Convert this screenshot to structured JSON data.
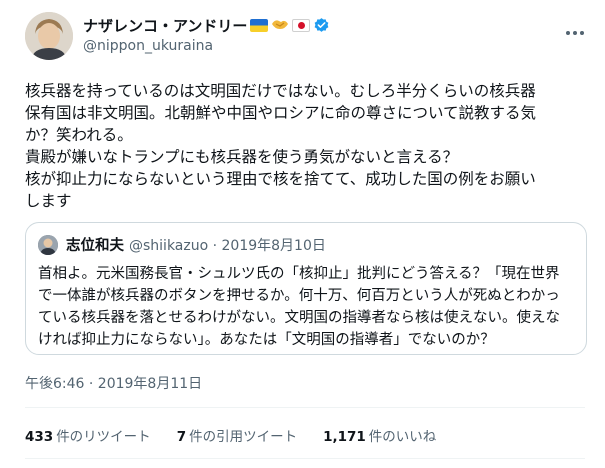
{
  "author": {
    "display_name": "ナザレンコ・アンドリー",
    "handle": "@nippon_ukuraina"
  },
  "tweet": {
    "lines": [
      "核兵器を持っているのは文明国だけではない。むしろ半分くらいの核兵器",
      "保有国は非文明国。北朝鮮や中国やロシアに命の尊さについて説教する気",
      "か？笑われる。",
      "貴殿が嫌いなトランプにも核兵器を使う勇気がないと言える？",
      "核が抑止力にならないという理由で核を捨てて、成功した国の例をお願い",
      "します"
    ]
  },
  "quoted_tweet": {
    "display_name": "志位和夫",
    "meta": "@shiikazuo · 2019年8月10日",
    "lines": [
      "首相よ。元米国務長官・シュルツ氏の「核抑止」批判にどう答える？「現在世界",
      "で一体誰が核兵器のボタンを押せるか。何十万、何百万という人が死ぬとわかっ",
      "ている核兵器を落とせるわけがない。文明国の指導者なら核は使えない。使えな",
      "ければ抑止力にならない」。あなたは「文明国の指導者」でないのか？"
    ]
  },
  "timestamp": "午後6:46 · 2019年8月11日",
  "stats": {
    "retweets_count": "433",
    "retweets_label": "件のリツイート",
    "quotes_count": "7",
    "quotes_label": "件の引用ツイート",
    "likes_count": "1,171",
    "likes_label": "件のいいね"
  },
  "icons": {
    "verified": "verified-badge-icon",
    "more": "more-options-icon",
    "handshake": "handshake-emoji-icon",
    "flag_ukraine": "ukraine-flag-icon",
    "flag_japan": "japan-flag-icon"
  },
  "colors": {
    "verified": "#1d9bf0",
    "secondary_text": "#536471",
    "border": "#cfd9de"
  }
}
